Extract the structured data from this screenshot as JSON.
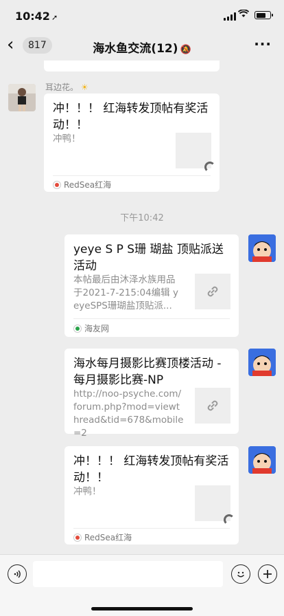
{
  "status": {
    "time": "10:42"
  },
  "nav": {
    "back_count": "817",
    "title": "海水鱼交流(12)"
  },
  "messages": [
    {
      "sender": "耳边花。",
      "title": "冲！！！ 红海转发顶帖有奖活动！！",
      "desc": "冲鸭！",
      "source": "RedSea红海"
    },
    {
      "timestamp": "下午10:42"
    },
    {
      "title": "yeye S P S珊 瑚盐 顶贴派送活动",
      "desc": "本帖最后由沐泽水族用品于2021-7-215:04编辑 yeyeSPS珊瑚盐顶贴派...",
      "source": "海友网"
    },
    {
      "title": "海水每月摄影比赛顶楼活动 - 每月摄影比赛-NP",
      "desc": "http://noo-psyche.com/forum.php?mod=viewthread&tid=678&mobile=2"
    },
    {
      "title": "冲！！！ 红海转发顶帖有奖活动！！",
      "desc": "冲鸭！",
      "source": "RedSea红海"
    }
  ],
  "input": {
    "placeholder": ""
  }
}
